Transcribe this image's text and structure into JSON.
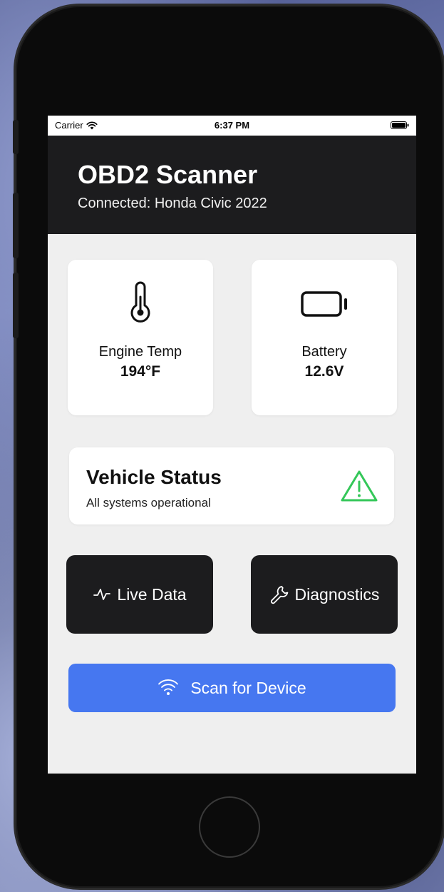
{
  "status_bar": {
    "carrier": "Carrier",
    "time": "6:37 PM",
    "wifi_icon": "wifi-icon",
    "battery_icon": "battery-full-icon"
  },
  "header": {
    "title": "OBD2 Scanner",
    "subtitle": "Connected: Honda Civic 2022"
  },
  "metrics": [
    {
      "label": "Engine Temp",
      "value": "194°F",
      "icon": "thermometer-icon"
    },
    {
      "label": "Battery",
      "value": "12.6V",
      "icon": "battery-icon"
    }
  ],
  "vehicle_status": {
    "title": "Vehicle Status",
    "description": "All systems operational",
    "icon": "warning-triangle-icon",
    "icon_color": "#34c759"
  },
  "actions": {
    "live_data_label": "Live Data",
    "live_data_icon": "activity-icon",
    "diagnostics_label": "Diagnostics",
    "diagnostics_icon": "wrench-icon"
  },
  "scan": {
    "label": "Scan for Device",
    "icon": "wifi-icon",
    "color": "#4677f0"
  },
  "colors": {
    "header_bg": "#1c1c1e",
    "screen_bg": "#efefef",
    "card_bg": "#ffffff",
    "accent": "#4677f0",
    "ok": "#34c759"
  }
}
